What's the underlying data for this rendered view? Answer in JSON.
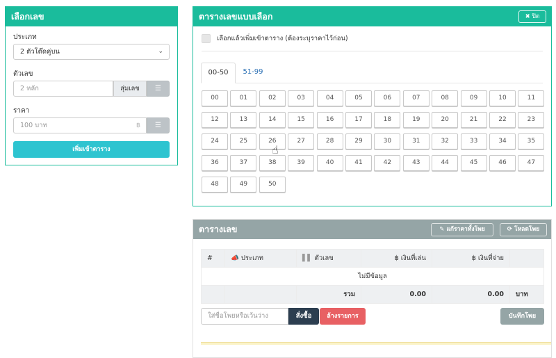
{
  "left": {
    "title": "เลือกเลข",
    "type_label": "ประเภท",
    "type_value": "2 ตัวโต๊ดคู่บน",
    "number_label": "ตัวเลข",
    "number_placeholder": "2 หลัก",
    "random_label": "สุ่มเลข",
    "price_label": "ราคา",
    "price_placeholder": "100 บาท",
    "currency": "฿",
    "add_label": "เพิ่มเข้าตาราง"
  },
  "grid": {
    "title": "ตารางเลขแบบเลือก",
    "close_label": "✖ ปิด",
    "checkbox_label": "เลือกแล้วเพิ่มเข้าตาราง (ต้องระบุราคาไว้ก่อน)",
    "tabs": [
      "00-50",
      "51-99"
    ],
    "numbers": [
      "00",
      "01",
      "02",
      "03",
      "04",
      "05",
      "06",
      "07",
      "08",
      "09",
      "10",
      "11",
      "12",
      "13",
      "14",
      "15",
      "16",
      "17",
      "18",
      "19",
      "20",
      "21",
      "22",
      "23",
      "24",
      "25",
      "26",
      "27",
      "28",
      "29",
      "30",
      "31",
      "32",
      "33",
      "34",
      "35",
      "36",
      "37",
      "38",
      "39",
      "40",
      "41",
      "42",
      "43",
      "44",
      "45",
      "46",
      "47",
      "48",
      "49",
      "50"
    ]
  },
  "table": {
    "title": "ตารางเลข",
    "edit_all_label": "แก้ราคาทั้งโพย",
    "load_label": "โหลดโพย",
    "headers": [
      "#",
      "ประเภท",
      "ตัวเลข",
      "฿ เงินที่เล่น",
      "฿ เงินที่จ่าย",
      ""
    ],
    "empty_text": "ไม่มีข้อมูล",
    "total_label": "รวม",
    "total_bet": "0.00",
    "total_pay": "0.00",
    "unit": "บาท",
    "note_placeholder": "ใส่ชื่อโพยหรือเว้นว่าง",
    "order_label": "สั่งซื้อ",
    "clear_label": "ล้างรายการ",
    "save_label": "บันทึกโพย"
  }
}
